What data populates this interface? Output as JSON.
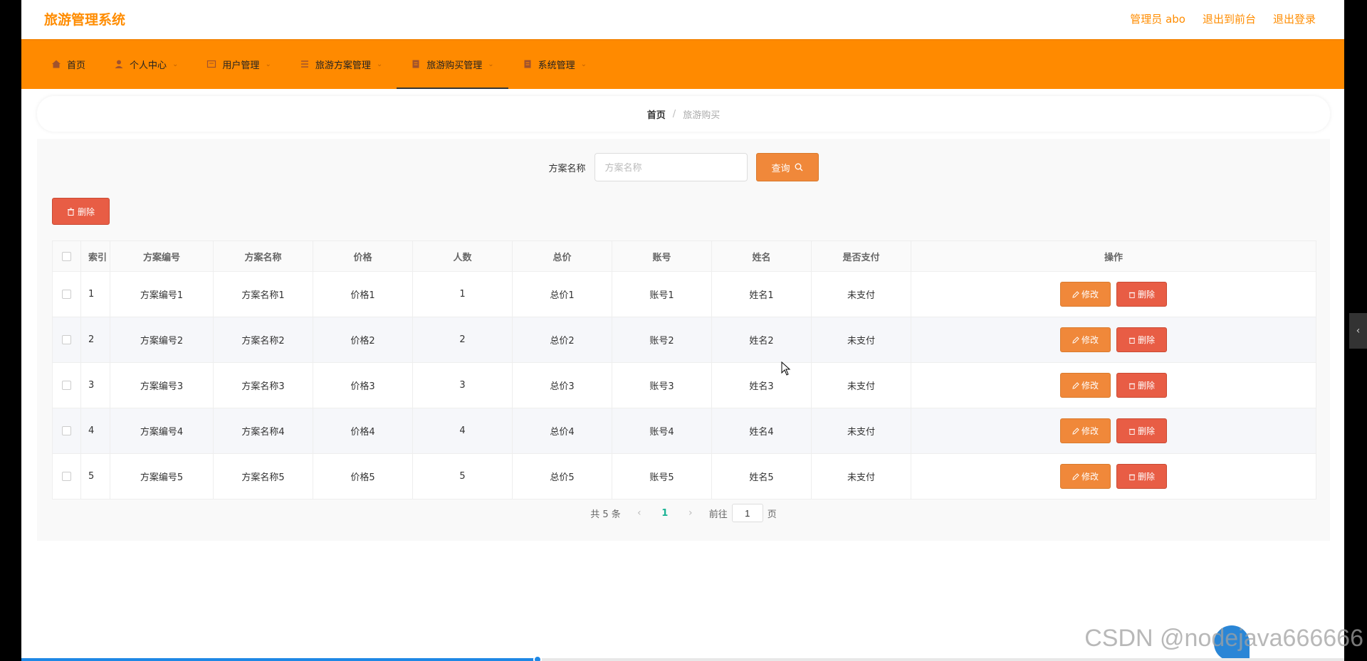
{
  "header": {
    "title": "旅游管理系统",
    "links": [
      "管理员 abo",
      "退出到前台",
      "退出登录"
    ]
  },
  "nav": {
    "items": [
      {
        "label": "首页",
        "icon": "home-icon",
        "has_arrow": false,
        "active": false
      },
      {
        "label": "个人中心",
        "icon": "user-icon",
        "has_arrow": true,
        "active": false
      },
      {
        "label": "用户管理",
        "icon": "card-icon",
        "has_arrow": true,
        "active": false
      },
      {
        "label": "旅游方案管理",
        "icon": "list-icon",
        "has_arrow": true,
        "active": false
      },
      {
        "label": "旅游购买管理",
        "icon": "doc-icon",
        "has_arrow": true,
        "active": true
      },
      {
        "label": "系统管理",
        "icon": "doc-icon",
        "has_arrow": true,
        "active": false
      }
    ]
  },
  "breadcrumb": {
    "home": "首页",
    "separator": "/",
    "current": "旅游购买"
  },
  "search": {
    "label": "方案名称",
    "placeholder": "方案名称",
    "value": "",
    "button": "查询"
  },
  "toolbar": {
    "delete_label": "删除"
  },
  "table": {
    "columns": [
      "索引",
      "方案编号",
      "方案名称",
      "价格",
      "人数",
      "总价",
      "账号",
      "姓名",
      "是否支付",
      "操作"
    ],
    "rows": [
      {
        "idx": "1",
        "code": "方案编号1",
        "name": "方案名称1",
        "price": "价格1",
        "people": "1",
        "total": "总价1",
        "account": "账号1",
        "person": "姓名1",
        "paid": "未支付"
      },
      {
        "idx": "2",
        "code": "方案编号2",
        "name": "方案名称2",
        "price": "价格2",
        "people": "2",
        "total": "总价2",
        "account": "账号2",
        "person": "姓名2",
        "paid": "未支付"
      },
      {
        "idx": "3",
        "code": "方案编号3",
        "name": "方案名称3",
        "price": "价格3",
        "people": "3",
        "total": "总价3",
        "account": "账号3",
        "person": "姓名3",
        "paid": "未支付"
      },
      {
        "idx": "4",
        "code": "方案编号4",
        "name": "方案名称4",
        "price": "价格4",
        "people": "4",
        "total": "总价4",
        "account": "账号4",
        "person": "姓名4",
        "paid": "未支付"
      },
      {
        "idx": "5",
        "code": "方案编号5",
        "name": "方案名称5",
        "price": "价格5",
        "people": "5",
        "total": "总价5",
        "account": "账号5",
        "person": "姓名5",
        "paid": "未支付"
      }
    ],
    "edit_label": "修改",
    "delete_label": "删除"
  },
  "pagination": {
    "total_text": "共 5 条",
    "current_page": "1",
    "goto_prefix": "前往",
    "goto_value": "1",
    "goto_suffix": "页"
  },
  "video_progress": 0.39,
  "watermark": "CSDN @nodejava666666",
  "colors": {
    "accent": "#ff8a00",
    "button_orange": "#f0883a",
    "button_red": "#e85d45",
    "page_active": "#1ab394"
  }
}
